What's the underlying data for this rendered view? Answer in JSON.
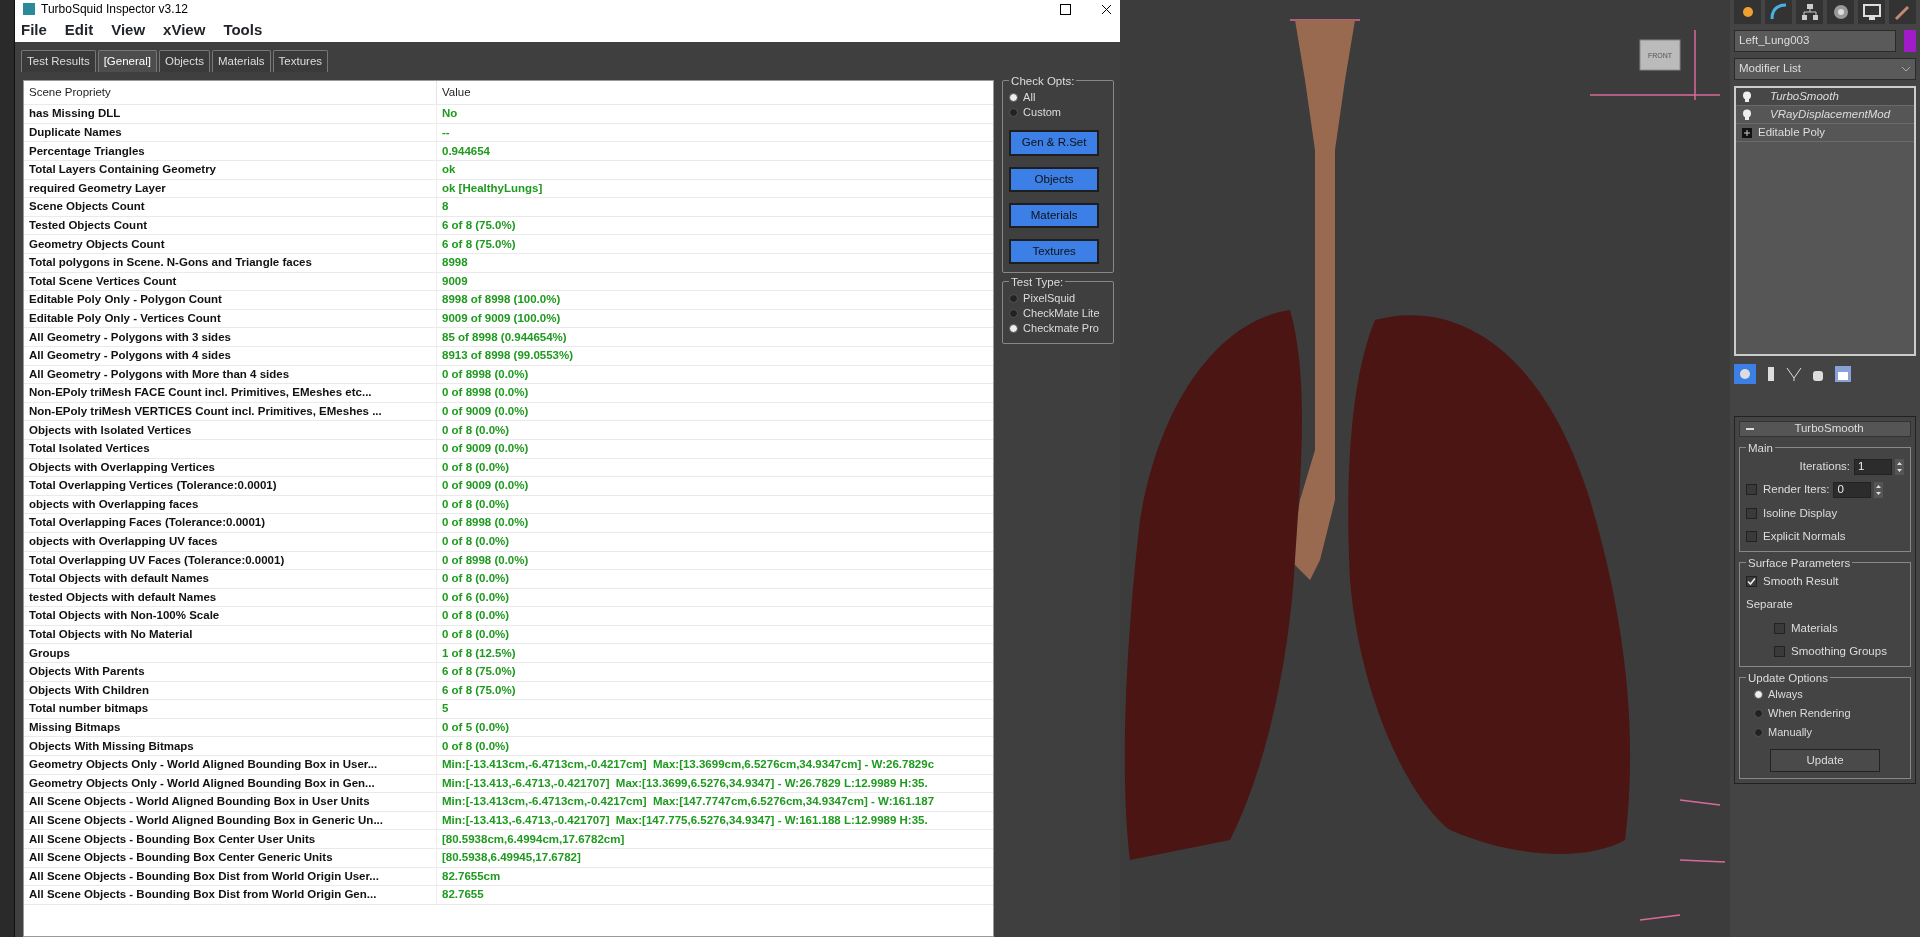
{
  "window": {
    "title": "TurboSquid Inspector v3.12"
  },
  "menu": [
    "File",
    "Edit",
    "View",
    "xView",
    "Tools"
  ],
  "tabs": [
    {
      "label": "Test Results",
      "selected": false
    },
    {
      "label": "[General]",
      "selected": true
    },
    {
      "label": "Objects",
      "selected": false
    },
    {
      "label": "Materials",
      "selected": false
    },
    {
      "label": "Textures",
      "selected": false
    }
  ],
  "table": {
    "columns": [
      "Scene Propriety",
      "Value"
    ],
    "rows": [
      [
        "has Missing DLL",
        "No"
      ],
      [
        "Duplicate Names",
        "--"
      ],
      [
        "Percentage Triangles",
        "0.944654"
      ],
      [
        "Total Layers Containing Geometry",
        "ok"
      ],
      [
        "required Geometry Layer",
        "ok [HealthyLungs]"
      ],
      [
        "Scene Objects Count",
        "8"
      ],
      [
        "Tested Objects Count",
        "6 of 8 (75.0%)"
      ],
      [
        "Geometry Objects Count",
        "6 of 8 (75.0%)"
      ],
      [
        "Total polygons in Scene. N-Gons and Triangle faces",
        "8998"
      ],
      [
        "Total Scene Vertices Count",
        "9009"
      ],
      [
        "Editable Poly Only - Polygon Count",
        "8998 of 8998 (100.0%)"
      ],
      [
        "Editable Poly Only - Vertices Count",
        "9009 of 9009 (100.0%)"
      ],
      [
        "All Geometry - Polygons with 3 sides",
        "85 of 8998 (0.944654%)"
      ],
      [
        "All Geometry - Polygons with 4 sides",
        "8913 of 8998 (99.0553%)"
      ],
      [
        "All Geometry - Polygons with More than 4 sides",
        "0 of 8998 (0.0%)"
      ],
      [
        "Non-EPoly triMesh FACE Count incl. Primitives, EMeshes etc...",
        "0 of 8998 (0.0%)"
      ],
      [
        "Non-EPoly triMesh VERTICES Count incl. Primitives, EMeshes ...",
        "0 of 9009 (0.0%)"
      ],
      [
        "Objects with Isolated Vertices",
        "0 of 8 (0.0%)"
      ],
      [
        "Total Isolated Vertices",
        "0 of 9009 (0.0%)"
      ],
      [
        "Objects with Overlapping Vertices",
        "0 of 8 (0.0%)"
      ],
      [
        "Total Overlapping Vertices (Tolerance:0.0001)",
        "0 of 9009 (0.0%)"
      ],
      [
        "objects with Overlapping faces",
        "0 of 8 (0.0%)"
      ],
      [
        "Total Overlapping Faces (Tolerance:0.0001)",
        "0 of 8998 (0.0%)"
      ],
      [
        "objects with Overlapping UV faces",
        "0 of 8 (0.0%)"
      ],
      [
        "Total Overlapping UV Faces (Tolerance:0.0001)",
        "0 of 8998 (0.0%)"
      ],
      [
        "Total Objects with default Names",
        "0 of 8 (0.0%)"
      ],
      [
        "tested Objects with default Names",
        "0 of 6 (0.0%)"
      ],
      [
        "Total Objects with Non-100% Scale",
        "0 of 8 (0.0%)"
      ],
      [
        "Total Objects with No Material",
        "0 of 8 (0.0%)"
      ],
      [
        "Groups",
        "1 of 8 (12.5%)"
      ],
      [
        "Objects With Parents",
        "6 of 8 (75.0%)"
      ],
      [
        "Objects With Children",
        "6 of 8 (75.0%)"
      ],
      [
        "Total number bitmaps",
        "5"
      ],
      [
        "Missing Bitmaps",
        "0 of 5 (0.0%)"
      ],
      [
        "Objects With Missing Bitmaps",
        "0 of 8 (0.0%)"
      ],
      [
        "Geometry Objects Only - World Aligned Bounding Box in User...",
        "Min:[-13.413cm,-6.4713cm,-0.4217cm]  Max:[13.3699cm,6.5276cm,34.9347cm] - W:26.7829c"
      ],
      [
        "Geometry Objects Only - World Aligned Bounding Box in Gen...",
        "Min:[-13.413,-6.4713,-0.421707]  Max:[13.3699,6.5276,34.9347] - W:26.7829 L:12.9989 H:35."
      ],
      [
        "All Scene Objects - World Aligned Bounding Box in User Units",
        "Min:[-13.413cm,-6.4713cm,-0.4217cm]  Max:[147.7747cm,6.5276cm,34.9347cm] - W:161.187"
      ],
      [
        "All Scene Objects - World Aligned Bounding Box in Generic Un...",
        "Min:[-13.413,-6.4713,-0.421707]  Max:[147.775,6.5276,34.9347] - W:161.188 L:12.9989 H:35."
      ],
      [
        "All Scene Objects - Bounding Box Center User Units",
        "[80.5938cm,6.4994cm,17.6782cm]"
      ],
      [
        "All Scene Objects - Bounding Box Center Generic Units",
        "[80.5938,6.49945,17.6782]"
      ],
      [
        "All Scene Objects - Bounding Box Dist from World Origin User...",
        "82.7655cm"
      ],
      [
        "All Scene Objects - Bounding Box Dist from World Origin Gen...",
        "82.7655"
      ]
    ]
  },
  "check_opts": {
    "title": "Check Opts:",
    "options": [
      {
        "label": "All",
        "selected": true
      },
      {
        "label": "Custom",
        "selected": false
      }
    ],
    "buttons": [
      "Gen & R.Set",
      "Objects",
      "Materials",
      "Textures"
    ]
  },
  "test_type": {
    "title": "Test Type:",
    "options": [
      {
        "label": "PixelSquid",
        "selected": false
      },
      {
        "label": "CheckMate Lite",
        "selected": false
      },
      {
        "label": "Checkmate Pro",
        "selected": true
      }
    ]
  },
  "viewport": {
    "view_cube": "FRONT"
  },
  "command_panel": {
    "object_name": "Left_Lung003",
    "modifier_list": "Modifier List",
    "stack": [
      {
        "label": "TurboSmooth",
        "kind": "modifier",
        "selected": true
      },
      {
        "label": "VRayDisplacementMod",
        "kind": "modifier",
        "selected": false
      },
      {
        "label": "Editable Poly",
        "kind": "base",
        "selected": false
      }
    ],
    "rollout": {
      "title": "TurboSmooth",
      "main": {
        "title": "Main",
        "iterations_label": "Iterations:",
        "iterations": "1",
        "render_iters_label": "Render Iters:",
        "render_iters_checked": false,
        "render_iters": "0",
        "checkboxes": [
          {
            "label": "Isoline Display",
            "checked": false
          },
          {
            "label": "Explicit Normals",
            "checked": false
          }
        ]
      },
      "surface": {
        "title": "Surface Parameters",
        "smooth_result": {
          "label": "Smooth Result",
          "checked": true
        },
        "separate_label": "Separate",
        "separate": [
          {
            "label": "Materials",
            "checked": false
          },
          {
            "label": "Smoothing Groups",
            "checked": false
          }
        ]
      },
      "update": {
        "title": "Update Options",
        "options": [
          {
            "label": "Always",
            "selected": true
          },
          {
            "label": "When Rendering",
            "selected": false
          },
          {
            "label": "Manually",
            "selected": false
          }
        ],
        "button": "Update"
      }
    }
  }
}
